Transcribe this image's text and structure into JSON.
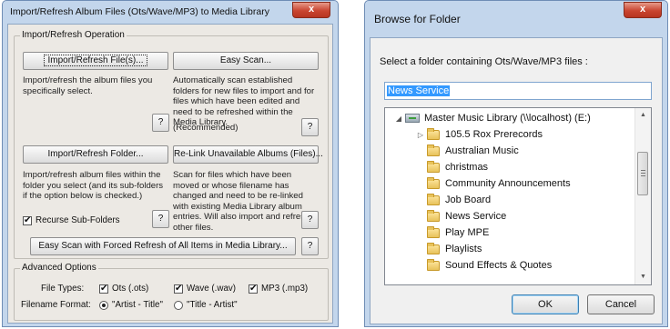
{
  "import_dialog": {
    "title": "Import/Refresh Album Files (Ots/Wave/MP3) to Media Library",
    "close_glyph": "x",
    "operation_group_label": "Import/Refresh Operation",
    "import_files_button": "Import/Refresh File(s)...",
    "import_files_desc": "Import/refresh the album files you specifically select.",
    "easy_scan_button": "Easy Scan...",
    "easy_scan_desc": "Automatically scan established folders for new files to import and for files which have been edited and need to be refreshed within the Media Library.",
    "easy_scan_recommended": "(Recommended)",
    "import_folder_button": "Import/Refresh Folder...",
    "import_folder_desc": "Import/refresh album files within the folder you select (and its sub-folders if the option below is checked.)",
    "relink_button": "Re-Link Unavailable Albums (Files)...",
    "relink_desc": "Scan for files which have been moved or whose filename has changed and need to be re-linked with existing Media Library album entries. Will also import and refresh other files.",
    "recurse_label": "Recurse Sub-Folders",
    "recurse_checked": true,
    "forced_refresh_button": "Easy Scan with Forced Refresh of All Items in Media Library...",
    "help_label": "?",
    "advanced_group_label": "Advanced Options",
    "file_types_label": "File Types:",
    "file_types": [
      {
        "label": "Ots (.ots)",
        "checked": true
      },
      {
        "label": "Wave (.wav)",
        "checked": true
      },
      {
        "label": "MP3 (.mp3)",
        "checked": true
      }
    ],
    "filename_format_label": "Filename Format:",
    "filename_formats": [
      {
        "label": "\"Artist - Title\"",
        "selected": true
      },
      {
        "label": "\"Title - Artist\"",
        "selected": false
      }
    ],
    "check_glyph": "✔"
  },
  "browse_dialog": {
    "title": "Browse for Folder",
    "close_glyph": "x",
    "prompt": "Select a folder containing Ots/Wave/MP3 files :",
    "folder_input_value": "News Service",
    "root_node": "Master Music Library (\\\\localhost) (E:)",
    "root_expand_glyph": "◢",
    "child_expand_glyph": "▷",
    "folders": [
      "105.5 Rox Prerecords",
      "Australian Music",
      "christmas",
      "Community Announcements",
      "Job Board",
      "News Service",
      "Play MPE",
      "Playlists",
      "Sound Effects & Quotes"
    ],
    "scroll_up_glyph": "▲",
    "scroll_down_glyph": "▼",
    "ok_button": "OK",
    "cancel_button": "Cancel"
  }
}
